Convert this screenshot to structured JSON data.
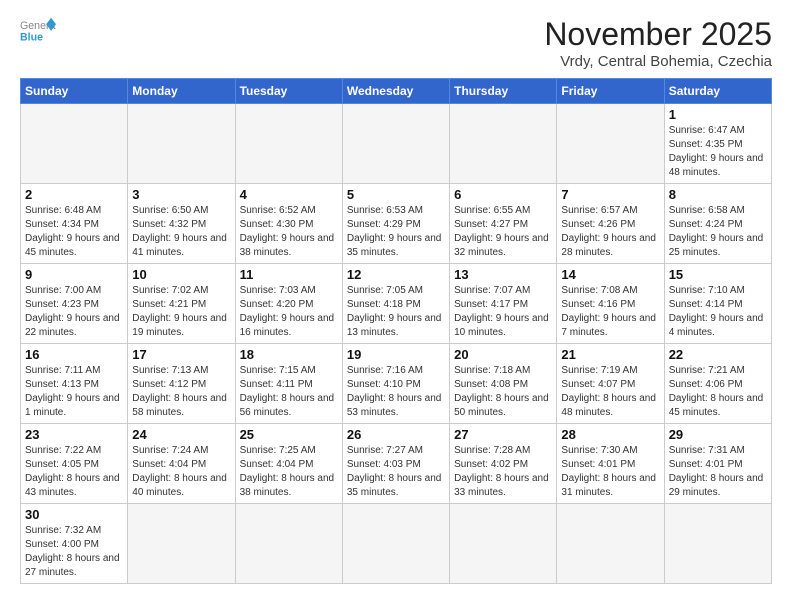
{
  "header": {
    "logo_general": "General",
    "logo_blue": "Blue",
    "month_title": "November 2025",
    "location": "Vrdy, Central Bohemia, Czechia"
  },
  "weekdays": [
    "Sunday",
    "Monday",
    "Tuesday",
    "Wednesday",
    "Thursday",
    "Friday",
    "Saturday"
  ],
  "weeks": [
    [
      {
        "day": "",
        "info": "",
        "empty": true
      },
      {
        "day": "",
        "info": "",
        "empty": true
      },
      {
        "day": "",
        "info": "",
        "empty": true
      },
      {
        "day": "",
        "info": "",
        "empty": true
      },
      {
        "day": "",
        "info": "",
        "empty": true
      },
      {
        "day": "",
        "info": "",
        "empty": true
      },
      {
        "day": "1",
        "info": "Sunrise: 6:47 AM\nSunset: 4:35 PM\nDaylight: 9 hours and 48 minutes.",
        "empty": false
      }
    ],
    [
      {
        "day": "2",
        "info": "Sunrise: 6:48 AM\nSunset: 4:34 PM\nDaylight: 9 hours and 45 minutes.",
        "empty": false
      },
      {
        "day": "3",
        "info": "Sunrise: 6:50 AM\nSunset: 4:32 PM\nDaylight: 9 hours and 41 minutes.",
        "empty": false
      },
      {
        "day": "4",
        "info": "Sunrise: 6:52 AM\nSunset: 4:30 PM\nDaylight: 9 hours and 38 minutes.",
        "empty": false
      },
      {
        "day": "5",
        "info": "Sunrise: 6:53 AM\nSunset: 4:29 PM\nDaylight: 9 hours and 35 minutes.",
        "empty": false
      },
      {
        "day": "6",
        "info": "Sunrise: 6:55 AM\nSunset: 4:27 PM\nDaylight: 9 hours and 32 minutes.",
        "empty": false
      },
      {
        "day": "7",
        "info": "Sunrise: 6:57 AM\nSunset: 4:26 PM\nDaylight: 9 hours and 28 minutes.",
        "empty": false
      },
      {
        "day": "8",
        "info": "Sunrise: 6:58 AM\nSunset: 4:24 PM\nDaylight: 9 hours and 25 minutes.",
        "empty": false
      }
    ],
    [
      {
        "day": "9",
        "info": "Sunrise: 7:00 AM\nSunset: 4:23 PM\nDaylight: 9 hours and 22 minutes.",
        "empty": false
      },
      {
        "day": "10",
        "info": "Sunrise: 7:02 AM\nSunset: 4:21 PM\nDaylight: 9 hours and 19 minutes.",
        "empty": false
      },
      {
        "day": "11",
        "info": "Sunrise: 7:03 AM\nSunset: 4:20 PM\nDaylight: 9 hours and 16 minutes.",
        "empty": false
      },
      {
        "day": "12",
        "info": "Sunrise: 7:05 AM\nSunset: 4:18 PM\nDaylight: 9 hours and 13 minutes.",
        "empty": false
      },
      {
        "day": "13",
        "info": "Sunrise: 7:07 AM\nSunset: 4:17 PM\nDaylight: 9 hours and 10 minutes.",
        "empty": false
      },
      {
        "day": "14",
        "info": "Sunrise: 7:08 AM\nSunset: 4:16 PM\nDaylight: 9 hours and 7 minutes.",
        "empty": false
      },
      {
        "day": "15",
        "info": "Sunrise: 7:10 AM\nSunset: 4:14 PM\nDaylight: 9 hours and 4 minutes.",
        "empty": false
      }
    ],
    [
      {
        "day": "16",
        "info": "Sunrise: 7:11 AM\nSunset: 4:13 PM\nDaylight: 9 hours and 1 minute.",
        "empty": false
      },
      {
        "day": "17",
        "info": "Sunrise: 7:13 AM\nSunset: 4:12 PM\nDaylight: 8 hours and 58 minutes.",
        "empty": false
      },
      {
        "day": "18",
        "info": "Sunrise: 7:15 AM\nSunset: 4:11 PM\nDaylight: 8 hours and 56 minutes.",
        "empty": false
      },
      {
        "day": "19",
        "info": "Sunrise: 7:16 AM\nSunset: 4:10 PM\nDaylight: 8 hours and 53 minutes.",
        "empty": false
      },
      {
        "day": "20",
        "info": "Sunrise: 7:18 AM\nSunset: 4:08 PM\nDaylight: 8 hours and 50 minutes.",
        "empty": false
      },
      {
        "day": "21",
        "info": "Sunrise: 7:19 AM\nSunset: 4:07 PM\nDaylight: 8 hours and 48 minutes.",
        "empty": false
      },
      {
        "day": "22",
        "info": "Sunrise: 7:21 AM\nSunset: 4:06 PM\nDaylight: 8 hours and 45 minutes.",
        "empty": false
      }
    ],
    [
      {
        "day": "23",
        "info": "Sunrise: 7:22 AM\nSunset: 4:05 PM\nDaylight: 8 hours and 43 minutes.",
        "empty": false
      },
      {
        "day": "24",
        "info": "Sunrise: 7:24 AM\nSunset: 4:04 PM\nDaylight: 8 hours and 40 minutes.",
        "empty": false
      },
      {
        "day": "25",
        "info": "Sunrise: 7:25 AM\nSunset: 4:04 PM\nDaylight: 8 hours and 38 minutes.",
        "empty": false
      },
      {
        "day": "26",
        "info": "Sunrise: 7:27 AM\nSunset: 4:03 PM\nDaylight: 8 hours and 35 minutes.",
        "empty": false
      },
      {
        "day": "27",
        "info": "Sunrise: 7:28 AM\nSunset: 4:02 PM\nDaylight: 8 hours and 33 minutes.",
        "empty": false
      },
      {
        "day": "28",
        "info": "Sunrise: 7:30 AM\nSunset: 4:01 PM\nDaylight: 8 hours and 31 minutes.",
        "empty": false
      },
      {
        "day": "29",
        "info": "Sunrise: 7:31 AM\nSunset: 4:01 PM\nDaylight: 8 hours and 29 minutes.",
        "empty": false
      }
    ],
    [
      {
        "day": "30",
        "info": "Sunrise: 7:32 AM\nSunset: 4:00 PM\nDaylight: 8 hours and 27 minutes.",
        "empty": false
      },
      {
        "day": "",
        "info": "",
        "empty": true
      },
      {
        "day": "",
        "info": "",
        "empty": true
      },
      {
        "day": "",
        "info": "",
        "empty": true
      },
      {
        "day": "",
        "info": "",
        "empty": true
      },
      {
        "day": "",
        "info": "",
        "empty": true
      },
      {
        "day": "",
        "info": "",
        "empty": true
      }
    ]
  ]
}
